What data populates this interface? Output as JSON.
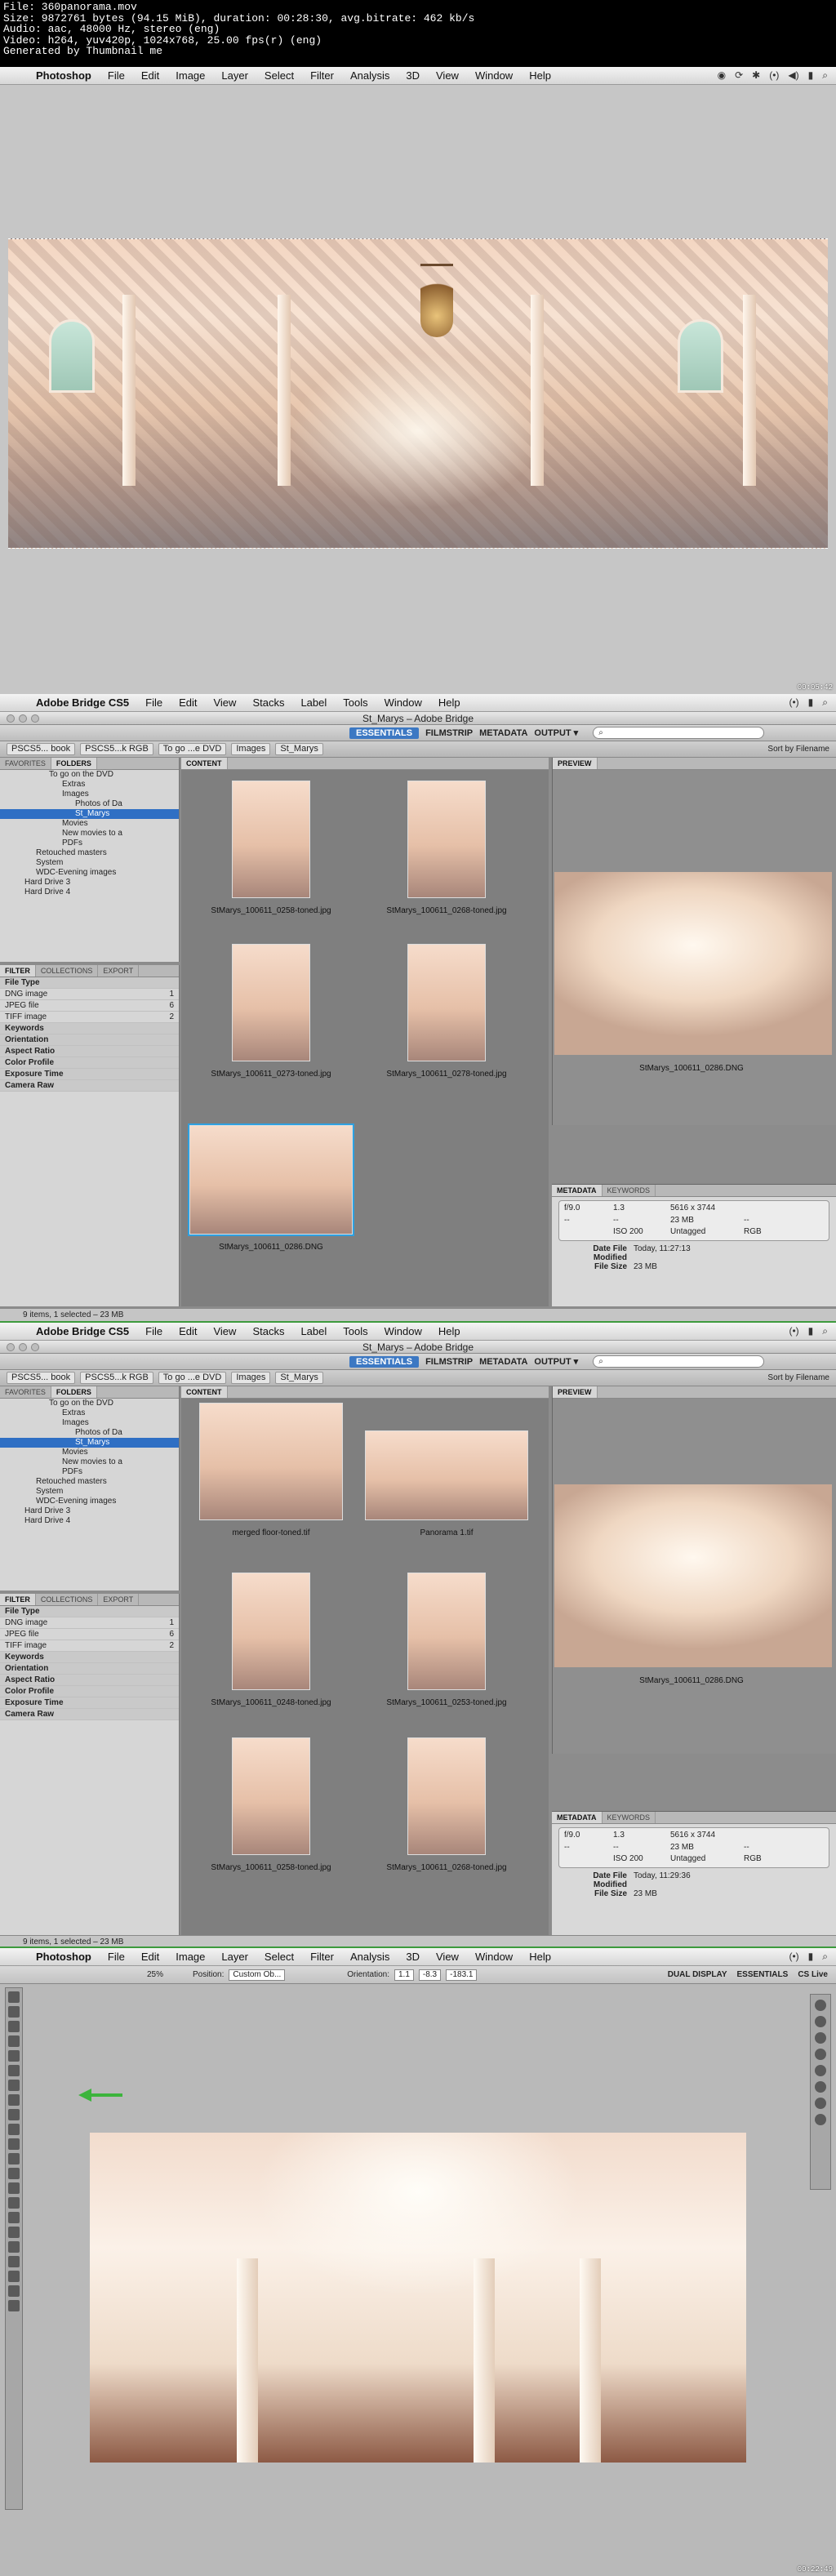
{
  "video_info": {
    "lines": [
      "File: 360panorama.mov",
      "Size: 9872761 bytes (94.15 MiB), duration: 00:28:30, avg.bitrate: 462 kb/s",
      "Audio: aac, 48000 Hz, stereo (eng)",
      "Video: h264, yuv420p, 1024x768, 25.00 fps(r) (eng)",
      "Generated by Thumbnail me"
    ]
  },
  "photoshop": {
    "app": "Photoshop",
    "menus": [
      "File",
      "Edit",
      "Image",
      "Layer",
      "Select",
      "Filter",
      "Analysis",
      "3D",
      "View",
      "Window",
      "Help"
    ],
    "options": {
      "position_label": "Position:",
      "position_value": "Custom Ob...",
      "orientation_label": "Orientation:",
      "x": "1.1",
      "y": "-8.3",
      "z": "-183.1",
      "zoom": "25%",
      "dual": "DUAL DISPLAY",
      "essentials": "ESSENTIALS",
      "cslive": "CS Live"
    }
  },
  "timestamps": [
    "00:05:42",
    "00:11:24",
    "00:17:07",
    "00:22:49"
  ],
  "bridge": {
    "app": "Adobe Bridge CS5",
    "menus": [
      "File",
      "Edit",
      "View",
      "Stacks",
      "Label",
      "Tools",
      "Window",
      "Help"
    ],
    "title": "St_Marys – Adobe Bridge",
    "workspaces": [
      "ESSENTIALS",
      "FILMSTRIP",
      "METADATA",
      "OUTPUT ▾"
    ],
    "breadcrumbs": [
      "PSCS5... book",
      "PSCS5...k RGB",
      "To go ...e DVD",
      "Images",
      "St_Marys"
    ],
    "sort": "Sort by Filename",
    "panel_tabs": [
      "FAVORITES",
      "FOLDERS"
    ],
    "content_tab": "CONTENT",
    "preview_tab": "PREVIEW",
    "filter_tabs": [
      "FILTER",
      "COLLECTIONS",
      "EXPORT"
    ],
    "tree": [
      "To go on the DVD",
      "Extras",
      "Images",
      "Photos of Da",
      "St_Marys",
      "Movies",
      "New movies to a",
      "PDFs",
      "Retouched masters",
      "System",
      "WDC-Evening images",
      "Hard Drive 3",
      "Hard Drive 4"
    ],
    "filters": [
      {
        "label": "File Type",
        "count": "",
        "hd": true
      },
      {
        "label": "DNG image",
        "count": "1"
      },
      {
        "label": "JPEG file",
        "count": "6"
      },
      {
        "label": "TIFF image",
        "count": "2"
      },
      {
        "label": "Keywords",
        "count": "",
        "hd": true
      },
      {
        "label": "Orientation",
        "count": "",
        "hd": true
      },
      {
        "label": "Aspect Ratio",
        "count": "",
        "hd": true
      },
      {
        "label": "Color Profile",
        "count": "",
        "hd": true
      },
      {
        "label": "Exposure Time",
        "count": "",
        "hd": true
      },
      {
        "label": "Camera Raw",
        "count": "",
        "hd": true
      }
    ],
    "meta_tabs": [
      "METADATA",
      "KEYWORDS"
    ],
    "meta_box": [
      "f/9.0",
      "1.3",
      "5616 x 3744",
      "--",
      "--",
      "23 MB",
      "--",
      "ISO 200",
      "Untagged",
      "RGB"
    ],
    "date_label": "Date File Modified",
    "size_label": "File Size",
    "size_value": "23 MB",
    "status": "9 items, 1 selected – 23 MB",
    "view1": {
      "thumbs": [
        "StMarys_100611_0258-toned.jpg",
        "StMarys_100611_0268-toned.jpg",
        "StMarys_100611_0273-toned.jpg",
        "StMarys_100611_0278-toned.jpg",
        "StMarys_100611_0286.DNG"
      ],
      "preview_name": "StMarys_100611_0286.DNG",
      "date": "Today, 11:27:13"
    },
    "view2": {
      "thumbs": [
        "merged floor-toned.tif",
        "Panorama 1.tif",
        "StMarys_100611_0248-toned.jpg",
        "StMarys_100611_0253-toned.jpg",
        "StMarys_100611_0258-toned.jpg",
        "StMarys_100611_0268-toned.jpg"
      ],
      "preview_name": "StMarys_100611_0286.DNG",
      "date": "Today, 11:29:36"
    }
  },
  "tray": [
    "◉",
    "⟳",
    "✱",
    "▲",
    "✉",
    "◐",
    "◈",
    "◀)",
    "✱",
    "(•)",
    "▮",
    "⌕"
  ],
  "colors": {
    "selection": "#2f6fc4",
    "workspace_active": "#3c78c3",
    "thumb_selected": "#2ea0e0"
  }
}
